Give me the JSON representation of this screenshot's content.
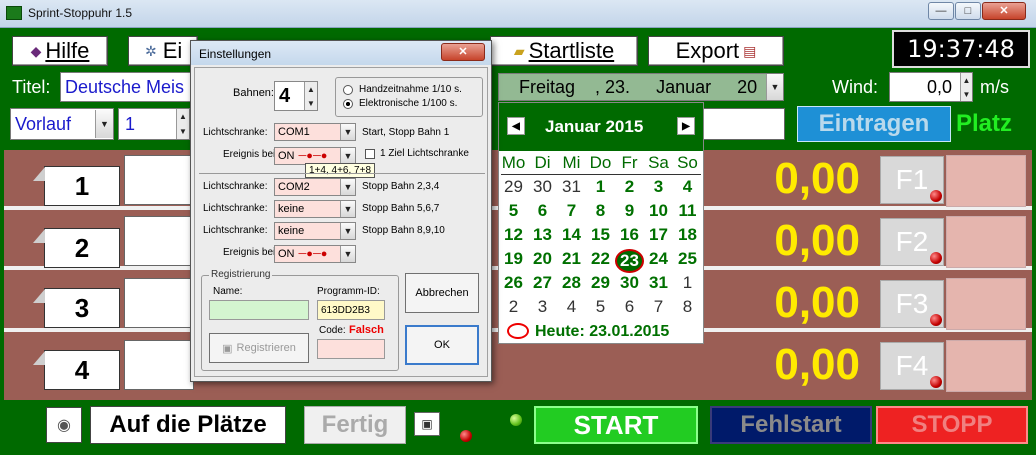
{
  "window": {
    "title": "Sprint-Stoppuhr 1.5",
    "min": "—",
    "max": "□",
    "close": "✕"
  },
  "toolbar": {
    "help_label": "Hilfe",
    "settings_label": "Ei",
    "startlist_label": "Startliste",
    "export_label": "Export",
    "clock": "19:37:48"
  },
  "row2": {
    "title_label": "Titel:",
    "title_value": "Deutsche Meis",
    "date_weekday": "Freitag",
    "date_day": ", 23.",
    "date_month": "Januar",
    "date_year": "20",
    "wind_label": "Wind:",
    "wind_value": "0,0",
    "wind_unit": "m/s"
  },
  "row3": {
    "round_value": "Vorlauf",
    "heat_value": "1",
    "enter_button": "Eintragen",
    "place_label": "Platz"
  },
  "lanes": [
    {
      "number": "1",
      "time": "0,00",
      "fkey": "F1"
    },
    {
      "number": "2",
      "time": "0,00",
      "fkey": "F2"
    },
    {
      "number": "3",
      "time": "0,00",
      "fkey": "F3"
    },
    {
      "number": "4",
      "time": "0,00",
      "fkey": "F4"
    }
  ],
  "bottom": {
    "ready_label": "Auf die Plätze",
    "done_label": "Fertig",
    "start_label": "START",
    "false_start_label": "Fehlstart",
    "stop_label": "STOPP"
  },
  "dialog": {
    "title": "Einstellungen",
    "close": "✕",
    "lanes_label": "Bahnen:",
    "lanes_value": "4",
    "radio_hand": "Handzeitnahme 1/10 s.",
    "radio_electronic": "Elektronische  1/100 s.",
    "ls_label": "Lichtschranke:",
    "event_label": "Ereignis bei:",
    "ls1_value": "COM1",
    "ls1_desc": "Start, Stopp Bahn 1",
    "event1_value": "ON",
    "one_goal_label": "1 Ziel Lichtschranke",
    "tooltip": "1+4, 4+6, 7+8",
    "ls2_value": "COM2",
    "ls2_desc": "Stopp Bahn 2,3,4",
    "ls3_value": "keine",
    "ls3_desc": "Stopp Bahn 5,6,7",
    "ls4_value": "keine",
    "ls4_desc": "Stopp Bahn 8,9,10",
    "event2_value": "ON",
    "reg_group": "Registrierung",
    "name_label": "Name:",
    "program_id_label": "Programm-ID:",
    "program_id_value": "613DD2B3",
    "code_label": "Code:",
    "code_status": "Falsch",
    "register_button": "Registrieren",
    "cancel_button": "Abbrechen",
    "ok_button": "OK"
  },
  "calendar": {
    "month_title": "Januar 2015",
    "prev": "◀",
    "next": "▶",
    "daynames": [
      "Mo",
      "Di",
      "Mi",
      "Do",
      "Fr",
      "Sa",
      "So"
    ],
    "weeks": [
      [
        "29",
        "30",
        "31",
        "1",
        "2",
        "3",
        "4"
      ],
      [
        "5",
        "6",
        "7",
        "8",
        "9",
        "10",
        "11"
      ],
      [
        "12",
        "13",
        "14",
        "15",
        "16",
        "17",
        "18"
      ],
      [
        "19",
        "20",
        "21",
        "22",
        "23",
        "24",
        "25"
      ],
      [
        "26",
        "27",
        "28",
        "29",
        "30",
        "31",
        "1"
      ],
      [
        "2",
        "3",
        "4",
        "5",
        "6",
        "7",
        "8"
      ]
    ],
    "today_label": "Heute: 23.01.2015"
  },
  "colors": {
    "accent_green": "#006a00",
    "time_yellow": "#ffea00",
    "lane_brown": "#9b5e55",
    "start_green": "#22cc22",
    "stop_red": "#ee2222"
  }
}
